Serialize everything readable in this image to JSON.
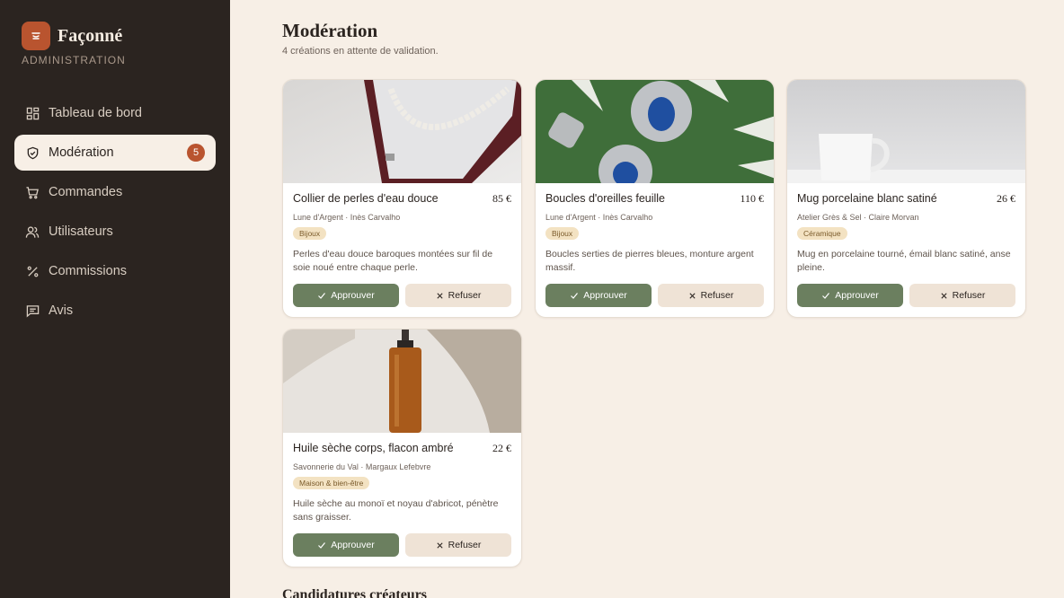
{
  "brand": {
    "name": "Façonné",
    "subtitle": "ADMINISTRATION",
    "logo_icon": "pot-icon",
    "accent": "#b9542f"
  },
  "sidebar": {
    "items": [
      {
        "label": "Tableau de bord",
        "icon": "dashboard-icon",
        "active": false
      },
      {
        "label": "Modération",
        "icon": "shield-check-icon",
        "active": true,
        "badge": "5"
      },
      {
        "label": "Commandes",
        "icon": "cart-icon",
        "active": false
      },
      {
        "label": "Utilisateurs",
        "icon": "users-icon",
        "active": false
      },
      {
        "label": "Commissions",
        "icon": "percent-icon",
        "active": false
      },
      {
        "label": "Avis",
        "icon": "message-icon",
        "active": false
      }
    ]
  },
  "main": {
    "title": "Modération",
    "subtitle": "4 créations en attente de validation.",
    "approve_label": "Approuver",
    "reject_label": "Refuser",
    "section_next": "Candidatures créateurs"
  },
  "cards": [
    {
      "title": "Collier de perles d'eau douce",
      "price": "85 €",
      "meta": "Lune d'Argent · Inès Carvalho",
      "tag": "Bijoux",
      "desc": "Perles d'eau douce baroques montées sur fil de soie noué entre chaque perle.",
      "image": "pearl-necklace"
    },
    {
      "title": "Boucles d'oreilles feuille",
      "price": "110 €",
      "meta": "Lune d'Argent · Inès Carvalho",
      "tag": "Bijoux",
      "desc": "Boucles serties de pierres bleues, monture argent massif.",
      "image": "earrings-leaf"
    },
    {
      "title": "Mug porcelaine blanc satiné",
      "price": "26 €",
      "meta": "Atelier Grès & Sel · Claire Morvan",
      "tag": "Céramique",
      "desc": "Mug en porcelaine tourné, émail blanc satiné, anse pleine.",
      "image": "white-mug"
    },
    {
      "title": "Huile sèche corps, flacon ambré",
      "price": "22 €",
      "meta": "Savonnerie du Val · Margaux Lefebvre",
      "tag": "Maison & bien-être",
      "desc": "Huile sèche au monoï et noyau d'abricot, pénètre sans graisser.",
      "image": "amber-bottle"
    }
  ],
  "colors": {
    "sidebar_bg": "#2b2420",
    "page_bg": "#f7efe6",
    "approve": "#6b7f5f",
    "reject": "#efe3d6",
    "tag_bg": "#f3e2c2"
  }
}
